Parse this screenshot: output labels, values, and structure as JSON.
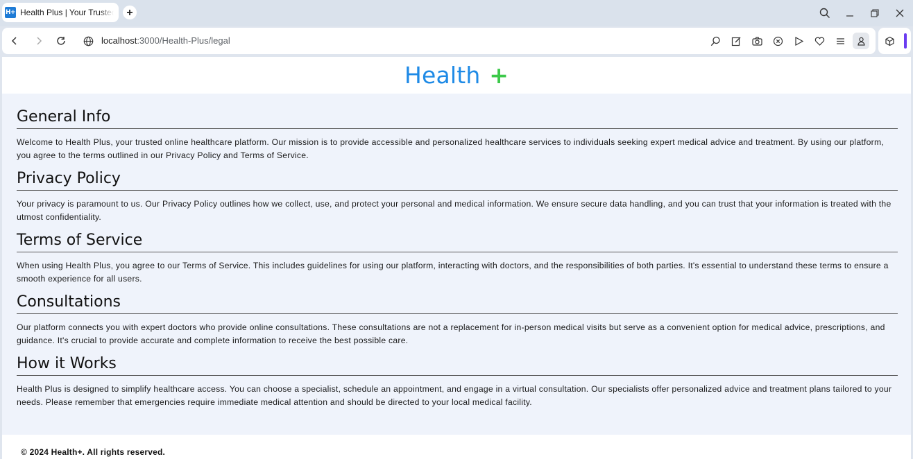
{
  "browser": {
    "tab": {
      "favicon": "H+",
      "title": "Health Plus | Your Trusted"
    },
    "url": {
      "host": "localhost",
      "path": ":3000/Health-Plus/legal"
    },
    "icons": [
      "back-icon",
      "forward-icon",
      "reload-icon",
      "site-info-icon",
      "search-icon",
      "edit-icon",
      "camera-icon",
      "shield-icon",
      "send-icon",
      "heart-icon",
      "menu-icon",
      "profile-icon",
      "cube-icon",
      "minimize-icon",
      "restore-icon",
      "close-icon"
    ]
  },
  "page": {
    "logo": {
      "text": "Health",
      "plus": "+"
    },
    "colors": {
      "logo_blue": "#1e8ae6",
      "logo_green": "#3cc94a",
      "background": "#eff3fb"
    },
    "sections": [
      {
        "heading": "General Info",
        "body": "Welcome to Health Plus, your trusted online healthcare platform. Our mission is to provide accessible and personalized healthcare services to individuals seeking expert medical advice and treatment. By using our platform, you agree to the terms outlined in our Privacy Policy and Terms of Service."
      },
      {
        "heading": "Privacy Policy",
        "body": "Your privacy is paramount to us. Our Privacy Policy outlines how we collect, use, and protect your personal and medical information. We ensure secure data handling, and you can trust that your information is treated with the utmost confidentiality."
      },
      {
        "heading": "Terms of Service",
        "body": "When using Health Plus, you agree to our Terms of Service. This includes guidelines for using our platform, interacting with doctors, and the responsibilities of both parties. It's essential to understand these terms to ensure a smooth experience for all users."
      },
      {
        "heading": "Consultations",
        "body": "Our platform connects you with expert doctors who provide online consultations. These consultations are not a replacement for in-person medical visits but serve as a convenient option for medical advice, prescriptions, and guidance. It's crucial to provide accurate and complete information to receive the best possible care."
      },
      {
        "heading": "How it Works",
        "body": "Health Plus is designed to simplify healthcare access. You can choose a specialist, schedule an appointment, and engage in a virtual consultation. Our specialists offer personalized advice and treatment plans tailored to your needs. Please remember that emergencies require immediate medical attention and should be directed to your local medical facility."
      }
    ],
    "footer": "© 2024 Health+. All rights reserved."
  }
}
